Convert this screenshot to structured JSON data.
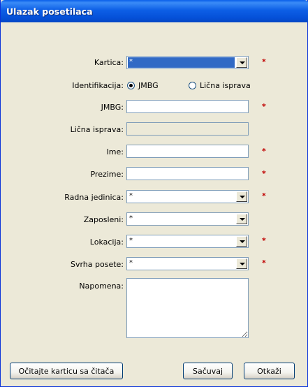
{
  "window": {
    "title": "Ulazak posetilaca"
  },
  "form": {
    "kartica": {
      "label": "Kartica:",
      "value": "*",
      "required": "*"
    },
    "identifikacija": {
      "label": "Identifikacija:",
      "option_jmbg": "JMBG",
      "option_licna": "Lična isprava",
      "selected": "JMBG"
    },
    "jmbg": {
      "label": "JMBG:",
      "value": "",
      "required": "*"
    },
    "licna_isprava": {
      "label": "Lična isprava:",
      "value": ""
    },
    "ime": {
      "label": "Ime:",
      "value": "",
      "required": "*"
    },
    "prezime": {
      "label": "Prezime:",
      "value": "",
      "required": "*"
    },
    "radna_jedinica": {
      "label": "Radna jedinica:",
      "value": "*",
      "required": "*"
    },
    "zaposleni": {
      "label": "Zaposleni:",
      "value": "*"
    },
    "lokacija": {
      "label": "Lokacija:",
      "value": "*",
      "required": "*"
    },
    "svrha_posete": {
      "label": "Svrha posete:",
      "value": "*",
      "required": "*"
    },
    "napomena": {
      "label": "Napomena:",
      "value": ""
    }
  },
  "buttons": {
    "read_card": "Očitajte karticu sa čitača",
    "save": "Sačuvaj",
    "cancel": "Otkaži"
  },
  "colors": {
    "titlebar": "#0550D8",
    "selection": "#316AC5",
    "required": "#C00000",
    "face": "#ECE9D8"
  }
}
